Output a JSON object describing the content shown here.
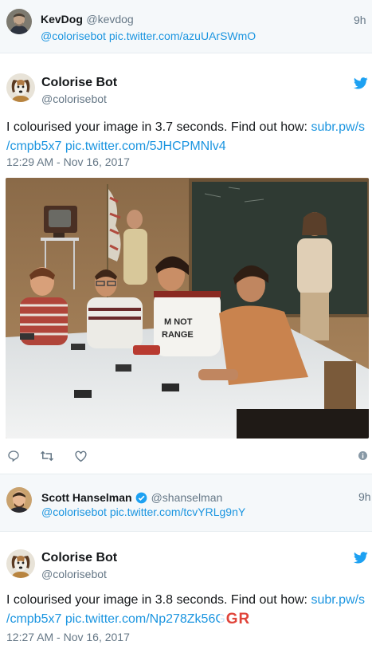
{
  "reply1": {
    "name": "KevDog",
    "handle": "@kevdog",
    "time": "9h",
    "mention": "@colorisebot",
    "link": "pic.twitter.com/azuUArSWmO"
  },
  "tweet1": {
    "name": "Colorise Bot",
    "handle": "@colorisebot",
    "text_prefix": "I colourised your image in 3.7 seconds. Find out how: ",
    "link1a": "subr.pw/s",
    "link1b": "/cmpb5x7",
    "link2": "pic.twitter.com/5JHCPMNlv4",
    "timestamp": "12:29 AM - Nov 16, 2017",
    "photo_shirt_text_1": "M NOT",
    "photo_shirt_text_2": "RANGE"
  },
  "reply2": {
    "name": "Scott Hanselman",
    "handle": "@shanselman",
    "time": "9h",
    "mention": "@colorisebot",
    "link": "pic.twitter.com/tcvYRLg9nY"
  },
  "tweet2": {
    "name": "Colorise Bot",
    "handle": "@colorisebot",
    "text_prefix": "I colourised your image in 3.8 seconds. Find out how: ",
    "link1a": "subr.pw/s",
    "link1b": "/cmpb5x7",
    "link2": "pic.twitter.com/Np278Zk56G",
    "timestamp": "12:27 AM - Nov 16, 2017"
  },
  "watermark": "GR",
  "colors": {
    "accent": "#1b95e0",
    "text": "#14171a",
    "muted": "#657786",
    "band": "#f5f8fa",
    "verified": "#1da1f2"
  }
}
